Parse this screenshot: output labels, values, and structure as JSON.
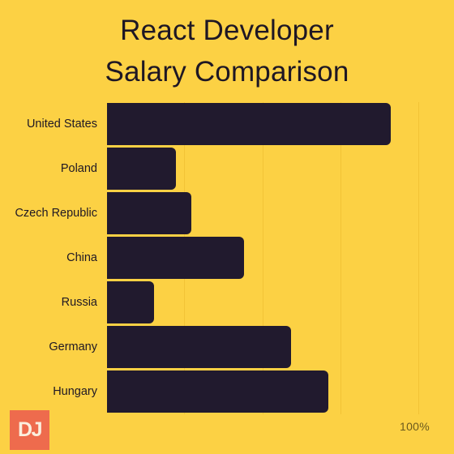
{
  "title": {
    "line1": "React Developer",
    "line2": "Salary Comparison"
  },
  "colors": {
    "background": "#FCD144",
    "bar": "#211A2E",
    "text": "#1E1724",
    "gridline": "#EFBE32",
    "logo_background": "#EE6B4D",
    "logo_text": "#FBEFDE",
    "axis_label": "#6B5A1E"
  },
  "axis": {
    "max_label": "100%"
  },
  "logo": {
    "text": "DJ"
  },
  "chart_data": {
    "type": "bar",
    "orientation": "horizontal",
    "title": "React Developer Salary Comparison",
    "xlabel": "",
    "ylabel": "",
    "xlim": [
      0,
      100
    ],
    "unit": "%",
    "grid": true,
    "gridlines": [
      25,
      50,
      75,
      100
    ],
    "legend": "none",
    "tick_labels": [
      "100%"
    ],
    "categories": [
      "United States",
      "Poland",
      "Czech Republic",
      "China",
      "Russia",
      "Germany",
      "Hungary"
    ],
    "values": [
      91,
      22,
      27,
      44,
      15,
      59,
      71
    ]
  }
}
